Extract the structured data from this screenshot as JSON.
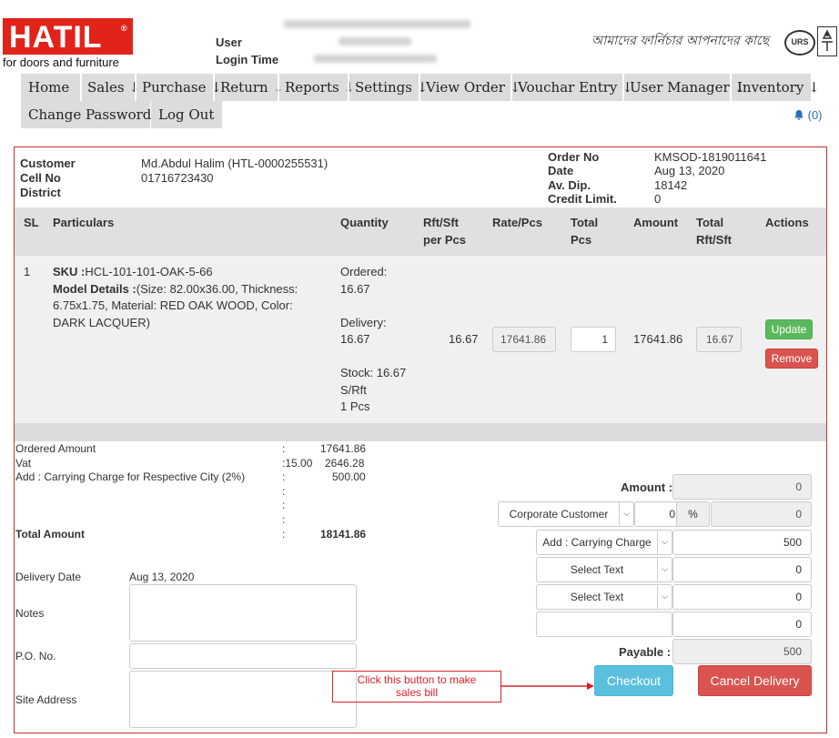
{
  "header": {
    "logo": "HATIL",
    "logo_reg": "®",
    "tagline": "for doors and furniture",
    "user_label": "User",
    "login_time_label": "Login Time",
    "slogan": "আমাদের ফার্নিচার আপনাদের কাছে",
    "cert_label": "URS"
  },
  "nav": {
    "row1": [
      "Home",
      "Sales ↓",
      "Purchase ↓",
      "Return ↓",
      "Reports ↓",
      "Settings ↓",
      "View Order ↓",
      "Vouchar Entry ↓",
      "User Manager ↓",
      "Inventory ↓"
    ],
    "row2": [
      "Change Password",
      "Log Out"
    ],
    "notifications": "(0)"
  },
  "customer": {
    "customer_label": "Customer",
    "customer_value": "Md.Abdul Halim (HTL-0000255531)",
    "cell_label": "Cell No",
    "cell_value": "01716723430",
    "district_label": "District"
  },
  "order": {
    "order_no_label": "Order No",
    "order_no_value": "KMSOD-1819011641",
    "date_label": "Date",
    "date_value": "Aug 13, 2020",
    "av_dip_label": "Av. Dip.",
    "av_dip_value": "18142",
    "credit_label": "Credit Limit.",
    "credit_value": "0"
  },
  "table": {
    "headers": {
      "sl": "SL",
      "particulars": "Particulars",
      "quantity": "Quantity",
      "rft_a": "Rft/Sft",
      "rft_b": "per Pcs",
      "rate": "Rate/Pcs",
      "total_a": "Total",
      "total_b": "Pcs",
      "amount": "Amount",
      "trft_a": "Total",
      "trft_b": "Rft/Sft",
      "actions": "Actions"
    },
    "row": {
      "sl": "1",
      "sku_label": "SKU :",
      "sku_value": "HCL-101-101-OAK-5-66",
      "model_label": "Model Details :",
      "model_l1": "(Size: 82.00x36.00, Thickness:",
      "model_l2": "6.75x1.75, Material: RED OAK WOOD, Color:",
      "model_l3": "DARK LACQUER)",
      "ordered_label": "Ordered:",
      "ordered_value": "16.67",
      "delivery_label": "Delivery:",
      "delivery_value": "16.67",
      "stock_label": "Stock: 16.67",
      "stock_unit": "S/Rft",
      "stock_pcs": "1 Pcs",
      "rft_per_pcs": "16.67",
      "rate_value": "17641.86",
      "total_pcs": "1",
      "amount": "17641.86",
      "total_rft": "16.67",
      "update_label": "Update",
      "remove_label": "Remove"
    }
  },
  "summary": {
    "ordered_amount_label": "Ordered Amount",
    "ordered_amount_value": "17641.86",
    "vat_label": "Vat",
    "vat_rate": ":15.00",
    "vat_value": "2646.28",
    "carry_label": "Add : Carrying Charge for Respective City (2%)",
    "carry_value": "500.00",
    "total_label": "Total Amount",
    "total_value": "18141.86",
    "colon": ":"
  },
  "delivery": {
    "delivery_date_label": "Delivery Date",
    "delivery_date_value": "Aug 13, 2020",
    "notes_label": "Notes",
    "po_label": "P.O. No.",
    "site_label": "Site Address"
  },
  "payment": {
    "amount_label": "Amount :",
    "amount_value": "0",
    "customer_type": "Corporate Customer",
    "discount_value": "0",
    "percent": "%",
    "discount_amount": "0",
    "carry_select": "Add : Carrying Charge",
    "carry_value": "500",
    "select1": "Select Text",
    "select1_value": "0",
    "select2": "Select Text",
    "select2_value": "0",
    "extra_value": "0",
    "payable_label": "Payable :",
    "payable_value": "500",
    "checkout_label": "Checkout",
    "cancel_label": "Cancel Delivery"
  },
  "annotation": {
    "line1": "Click this button to make",
    "line2": "sales bill"
  },
  "colors": {
    "brand_red": "#e2231a",
    "green": "#5cb85c",
    "danger": "#d9534f",
    "info": "#5bc0de"
  }
}
